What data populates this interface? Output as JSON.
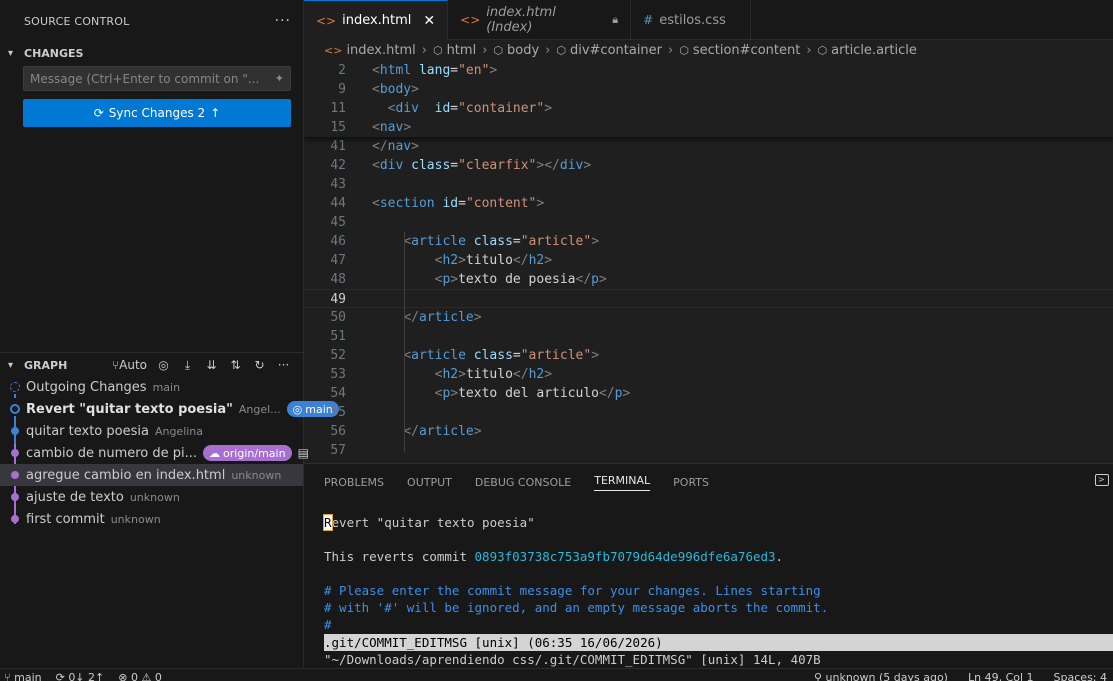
{
  "sidebar": {
    "title": "SOURCE CONTROL",
    "changes_title": "CHANGES",
    "message_placeholder": "Message (Ctrl+Enter to commit on \"...",
    "sync_label": "Sync Changes 2",
    "graph_title": "GRAPH",
    "graph_auto": "Auto",
    "graph": [
      {
        "message": "Outgoing Changes",
        "author": "main",
        "bold": false
      },
      {
        "message": "Revert \"quitar texto poesia\"",
        "author": "Angel...",
        "badge": "main",
        "bold": true
      },
      {
        "message": "quitar texto poesia",
        "author": "Angelina",
        "bold": false
      },
      {
        "message": "cambio de numero de pi...",
        "author": "",
        "badge": "origin/main",
        "bold": false
      },
      {
        "message": "agregue cambio en index.html",
        "author": "unknown",
        "bold": false
      },
      {
        "message": "ajuste de texto",
        "author": "unknown",
        "bold": false
      },
      {
        "message": "first commit",
        "author": "unknown",
        "bold": false
      }
    ]
  },
  "tabs": [
    {
      "label": "index.html",
      "icon": "<>",
      "active": true
    },
    {
      "label": "index.html (Index)",
      "icon": "<>",
      "active": false
    },
    {
      "label": "estilos.css",
      "icon": "#",
      "active": false
    }
  ],
  "breadcrumb": [
    "index.html",
    "html",
    "body",
    "div#container",
    "section#content",
    "article.article"
  ],
  "code": {
    "sticky": [
      {
        "n": "2",
        "text": "<html lang=\"en\">"
      },
      {
        "n": "9",
        "text": "<body>"
      },
      {
        "n": "11",
        "text": "  <div  id=\"container\">"
      },
      {
        "n": "15",
        "text": "<nav>"
      }
    ],
    "lines": [
      {
        "n": "41",
        "text": "</nav>"
      },
      {
        "n": "42",
        "text": "<div class=\"clearfix\"></div>"
      },
      {
        "n": "43",
        "text": ""
      },
      {
        "n": "44",
        "text": "<section id=\"content\">"
      },
      {
        "n": "45",
        "text": ""
      },
      {
        "n": "46",
        "text": "    <article class=\"article\">"
      },
      {
        "n": "47",
        "text": "        <h2>titulo</h2>"
      },
      {
        "n": "48",
        "text": "        <p>texto de poesia</p>"
      },
      {
        "n": "49",
        "text": ""
      },
      {
        "n": "50",
        "text": "    </article>"
      },
      {
        "n": "51",
        "text": ""
      },
      {
        "n": "52",
        "text": "    <article class=\"article\">"
      },
      {
        "n": "53",
        "text": "        <h2>titulo</h2>"
      },
      {
        "n": "54",
        "text": "        <p>texto del articulo</p>"
      },
      {
        "n": "55",
        "text": ""
      },
      {
        "n": "56",
        "text": "    </article>"
      },
      {
        "n": "57",
        "text": ""
      }
    ]
  },
  "panel": {
    "tabs": [
      "PROBLEMS",
      "OUTPUT",
      "DEBUG CONSOLE",
      "TERMINAL",
      "PORTS"
    ],
    "active_tab": "TERMINAL",
    "terminal_first_char": "R",
    "terminal_first_rest": "evert \"quitar texto poesia\"",
    "terminal_reverts": "This reverts commit ",
    "terminal_hash": "0893f03738c753a9fb7079d64de996dfe6a76ed3",
    "terminal_dot": ".",
    "terminal_comment1": "# Please enter the commit message for your changes. Lines starting",
    "terminal_comment2": "# with '#' will be ignored, and an empty message aborts the commit.",
    "terminal_comment3": "#",
    "terminal_status": ".git/COMMIT_EDITMSG [unix] (06:35 16/06/2026)",
    "terminal_last": "\"~/Downloads/aprendiendo css/.git/COMMIT_EDITMSG\" [unix] 14L, 407B"
  },
  "statusbar": {
    "branch": "main",
    "sync": "0↓ 2↑",
    "problems": "⊗ 0 ⚠ 0",
    "blame": "unknown (5 days ago)",
    "position": "Ln 49, Col 1",
    "spaces": "Spaces: 4"
  },
  "colors": {
    "accent": "#0078d4",
    "badge_main": "#3b82d6",
    "badge_origin": "#a66fd0"
  }
}
